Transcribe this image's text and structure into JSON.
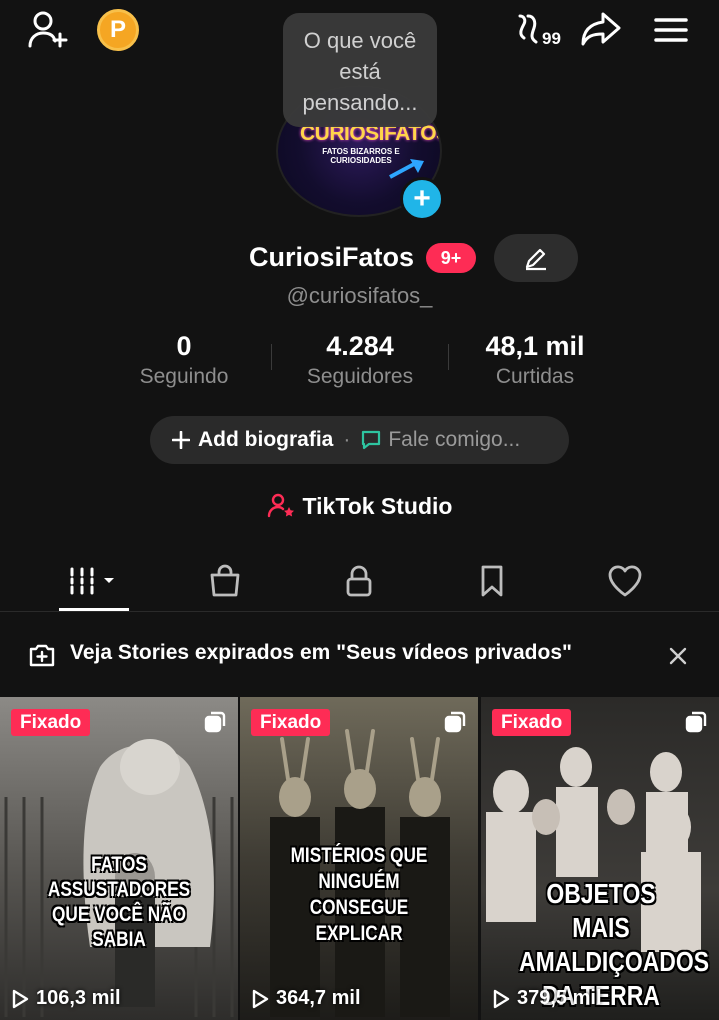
{
  "topbar": {
    "add_friend_icon": "add-user-icon",
    "coin_label": "P",
    "activity_label": "99",
    "share_icon": "share-icon",
    "menu_icon": "hamburger-menu-icon"
  },
  "tooltip": {
    "text": "O que você está pensando..."
  },
  "profile": {
    "avatar_logo": "CURIOSIFATOS",
    "avatar_sub": "FATOS BIZARROS E CURIOSIDADES",
    "name": "CuriosiFatos",
    "badge": "9+",
    "handle": "@curiosifatos_"
  },
  "stats": [
    {
      "value": "0",
      "label": "Seguindo"
    },
    {
      "value": "4.284",
      "label": "Seguidores"
    },
    {
      "value": "48,1 mil",
      "label": "Curtidas"
    }
  ],
  "bio": {
    "add_label": "Add biografia",
    "separator": "·",
    "chat_label": "Fale comigo..."
  },
  "studio": {
    "label": "TikTok Studio"
  },
  "tabs": [
    {
      "icon": "videos-grid-icon",
      "active": true
    },
    {
      "icon": "shopping-bag-icon",
      "active": false
    },
    {
      "icon": "lock-icon",
      "active": false
    },
    {
      "icon": "bookmark-icon",
      "active": false
    },
    {
      "icon": "heart-icon",
      "active": false
    }
  ],
  "stories_banner": {
    "text": "Veja Stories expirados em \"Seus vídeos privados\""
  },
  "videos": [
    {
      "pinned": "Fixado",
      "caption": "FATOS ASSUSTADORES QUE VOCÊ NÃO SABIA",
      "views": "106,3 mil"
    },
    {
      "pinned": "Fixado",
      "caption": "MISTÉRIOS QUE NINGUÉM CONSEGUE EXPLICAR",
      "views": "364,7 mil"
    },
    {
      "pinned": "Fixado",
      "caption": "OBJETOS MAIS AMALDIÇOADOS DA TERRA",
      "views": "379,5 mil"
    }
  ],
  "colors": {
    "background": "#121212",
    "accent_red": "#fe2c55",
    "accent_blue": "#20b5e8",
    "coin": "#f5a623",
    "muted_text": "#8e8e8e"
  }
}
